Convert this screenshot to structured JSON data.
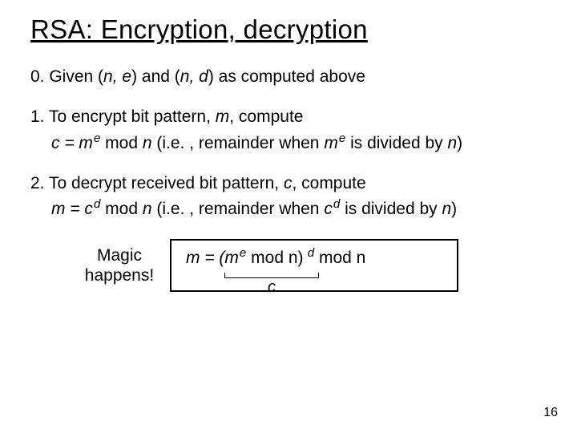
{
  "title": "RSA: Encryption, decryption",
  "step0": {
    "num": "0.",
    "text_a": " Given (",
    "ne": "n, e",
    "text_b": ") and (",
    "nd": "n, d",
    "text_c": ") as computed above"
  },
  "step1": {
    "num": "1.",
    "text_a": " To encrypt bit pattern, ",
    "m": "m",
    "text_b": ", compute",
    "line2_a": "c = m",
    "line2_e": "e",
    "line2_b": " mod  ",
    "line2_n": "n",
    "line2_c": "  (i.e. , remainder when ",
    "line2_m2": "m",
    "line2_e2": "e",
    "line2_d": " is divided by ",
    "line2_n2": "n",
    "line2_e3": ")"
  },
  "step2": {
    "num": "2.",
    "text_a": " To decrypt received bit pattern, ",
    "c": "c",
    "text_b": ", compute",
    "line2_a": "m = c",
    "line2_d1": "d",
    "line2_b": " mod  ",
    "line2_n": "n",
    "line2_c": "  (i.e. , remainder when ",
    "line2_c2": "c",
    "line2_d2": "d",
    "line2_e": " is divided by ",
    "line2_n2": "n",
    "line2_f": ")"
  },
  "magic": {
    "label_l1": "Magic",
    "label_l2": "happens!",
    "eq_a": "m  =  (m",
    "eq_e": "e",
    "eq_b": " mod  n)",
    "eq_d": " d",
    "eq_c": " mod  n",
    "brace_label": "c"
  },
  "pagenum": "16"
}
